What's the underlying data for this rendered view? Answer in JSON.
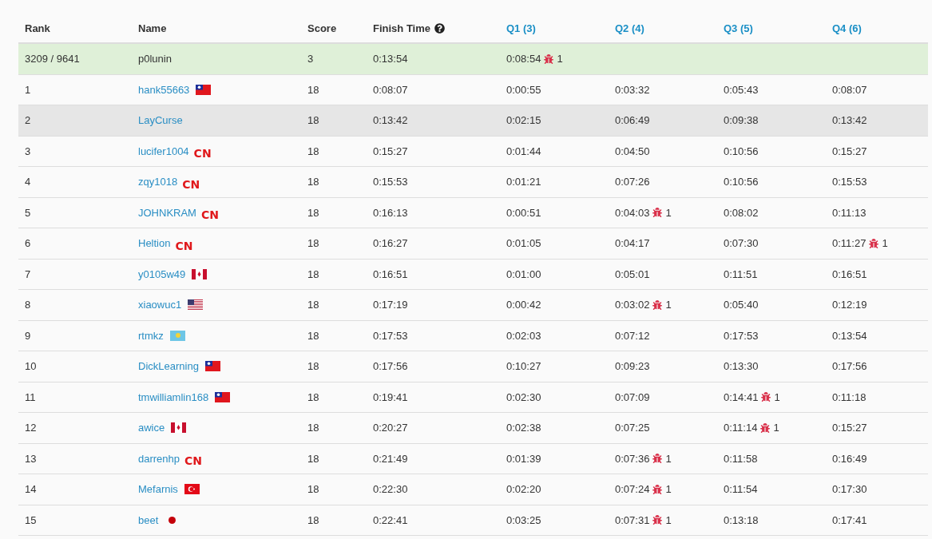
{
  "columns": [
    {
      "label": "Rank",
      "kind": "plain"
    },
    {
      "label": "Name",
      "kind": "plain"
    },
    {
      "label": "Score",
      "kind": "plain"
    },
    {
      "label": "Finish Time",
      "kind": "help"
    },
    {
      "label": "Q1 (3)",
      "kind": "link"
    },
    {
      "label": "Q2 (4)",
      "kind": "link"
    },
    {
      "label": "Q3 (5)",
      "kind": "link"
    },
    {
      "label": "Q4 (6)",
      "kind": "link"
    }
  ],
  "my_row": {
    "rank": "3209 / 9641",
    "name": "p0lunin",
    "score": "3",
    "finish": "0:13:54",
    "questions": [
      {
        "time": "0:08:54",
        "bugs": "1"
      }
    ]
  },
  "rows": [
    {
      "rank": "1",
      "name": "hank55663",
      "flag": {
        "kind": "tw"
      },
      "score": "18",
      "finish": "0:08:07",
      "hovered": false,
      "questions": [
        {
          "time": "0:00:55"
        },
        {
          "time": "0:03:32"
        },
        {
          "time": "0:05:43"
        },
        {
          "time": "0:08:07"
        }
      ]
    },
    {
      "rank": "2",
      "name": "LayCurse",
      "score": "18",
      "finish": "0:13:42",
      "hovered": true,
      "questions": [
        {
          "time": "0:02:15"
        },
        {
          "time": "0:06:49"
        },
        {
          "time": "0:09:38"
        },
        {
          "time": "0:13:42"
        }
      ]
    },
    {
      "rank": "3",
      "name": "lucifer1004",
      "country": "CN",
      "score": "18",
      "finish": "0:15:27",
      "hovered": false,
      "questions": [
        {
          "time": "0:01:44"
        },
        {
          "time": "0:04:50"
        },
        {
          "time": "0:10:56"
        },
        {
          "time": "0:15:27"
        }
      ]
    },
    {
      "rank": "4",
      "name": "zqy1018",
      "country": "CN",
      "score": "18",
      "finish": "0:15:53",
      "hovered": false,
      "questions": [
        {
          "time": "0:01:21"
        },
        {
          "time": "0:07:26"
        },
        {
          "time": "0:10:56"
        },
        {
          "time": "0:15:53"
        }
      ]
    },
    {
      "rank": "5",
      "name": "JOHNKRAM",
      "country": "CN",
      "score": "18",
      "finish": "0:16:13",
      "hovered": false,
      "questions": [
        {
          "time": "0:00:51"
        },
        {
          "time": "0:04:03",
          "bugs": "1"
        },
        {
          "time": "0:08:02"
        },
        {
          "time": "0:11:13"
        }
      ]
    },
    {
      "rank": "6",
      "name": "Heltion",
      "country": "CN",
      "score": "18",
      "finish": "0:16:27",
      "hovered": false,
      "questions": [
        {
          "time": "0:01:05"
        },
        {
          "time": "0:04:17"
        },
        {
          "time": "0:07:30"
        },
        {
          "time": "0:11:27",
          "bugs": "1"
        }
      ]
    },
    {
      "rank": "7",
      "name": "y0105w49",
      "flag": {
        "kind": "ca"
      },
      "score": "18",
      "finish": "0:16:51",
      "hovered": false,
      "questions": [
        {
          "time": "0:01:00"
        },
        {
          "time": "0:05:01"
        },
        {
          "time": "0:11:51"
        },
        {
          "time": "0:16:51"
        }
      ]
    },
    {
      "rank": "8",
      "name": "xiaowuc1",
      "flag": {
        "kind": "us"
      },
      "score": "18",
      "finish": "0:17:19",
      "hovered": false,
      "questions": [
        {
          "time": "0:00:42"
        },
        {
          "time": "0:03:02",
          "bugs": "1"
        },
        {
          "time": "0:05:40"
        },
        {
          "time": "0:12:19"
        }
      ]
    },
    {
      "rank": "9",
      "name": "rtmkz",
      "flag": {
        "kind": "kz"
      },
      "score": "18",
      "finish": "0:17:53",
      "hovered": false,
      "questions": [
        {
          "time": "0:02:03"
        },
        {
          "time": "0:07:12"
        },
        {
          "time": "0:17:53"
        },
        {
          "time": "0:13:54"
        }
      ]
    },
    {
      "rank": "10",
      "name": "DickLearning",
      "flag": {
        "kind": "tw"
      },
      "score": "18",
      "finish": "0:17:56",
      "hovered": false,
      "questions": [
        {
          "time": "0:10:27"
        },
        {
          "time": "0:09:23"
        },
        {
          "time": "0:13:30"
        },
        {
          "time": "0:17:56"
        }
      ]
    },
    {
      "rank": "11",
      "name": "tmwilliamlin168",
      "flag": {
        "kind": "tw"
      },
      "score": "18",
      "finish": "0:19:41",
      "hovered": false,
      "questions": [
        {
          "time": "0:02:30"
        },
        {
          "time": "0:07:09"
        },
        {
          "time": "0:14:41",
          "bugs": "1"
        },
        {
          "time": "0:11:18"
        }
      ]
    },
    {
      "rank": "12",
      "name": "awice",
      "flag": {
        "kind": "ca"
      },
      "score": "18",
      "finish": "0:20:27",
      "hovered": false,
      "questions": [
        {
          "time": "0:02:38"
        },
        {
          "time": "0:07:25"
        },
        {
          "time": "0:11:14",
          "bugs": "1"
        },
        {
          "time": "0:15:27"
        }
      ]
    },
    {
      "rank": "13",
      "name": "darrenhp",
      "country": "CN",
      "score": "18",
      "finish": "0:21:49",
      "hovered": false,
      "questions": [
        {
          "time": "0:01:39"
        },
        {
          "time": "0:07:36",
          "bugs": "1"
        },
        {
          "time": "0:11:58"
        },
        {
          "time": "0:16:49"
        }
      ]
    },
    {
      "rank": "14",
      "name": "Mefarnis",
      "flag": {
        "kind": "tr"
      },
      "score": "18",
      "finish": "0:22:30",
      "hovered": false,
      "questions": [
        {
          "time": "0:02:20"
        },
        {
          "time": "0:07:24",
          "bugs": "1"
        },
        {
          "time": "0:11:54"
        },
        {
          "time": "0:17:30"
        }
      ]
    },
    {
      "rank": "15",
      "name": "beet",
      "flag": {
        "kind": "dot"
      },
      "score": "18",
      "finish": "0:22:41",
      "hovered": false,
      "questions": [
        {
          "time": "0:03:25"
        },
        {
          "time": "0:07:31",
          "bugs": "1"
        },
        {
          "time": "0:13:18"
        },
        {
          "time": "0:17:41"
        }
      ]
    }
  ]
}
